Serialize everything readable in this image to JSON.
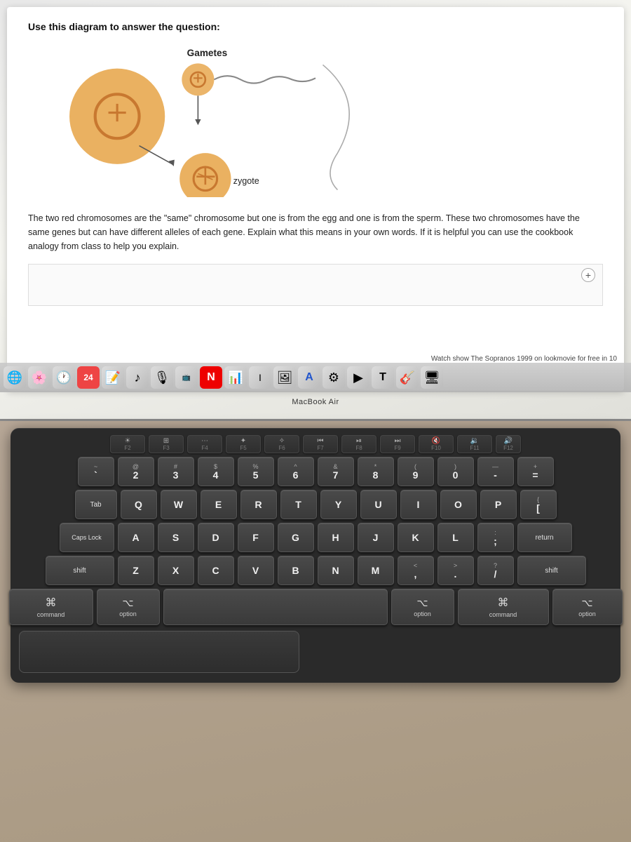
{
  "screen": {
    "question_header": "Use this diagram to answer the question:",
    "gametes_label": "Gametes",
    "zygote_label": "zygote",
    "question_text": "The two red chromosomes are the \"same\" chromosome but one is from the egg and one is from the sperm. These two chromosomes have the same genes but can have different alleles of each gene.  Explain what this means in your own words.  If it is helpful you can use the cookbook analogy from class to help you explain.",
    "notification": "Watch show The Sopranos 1999 on lookmovie for free in 10",
    "macbook_label": "MacBook Air"
  },
  "keyboard": {
    "fn_row": [
      {
        "label": "F2",
        "symbol": "☀"
      },
      {
        "label": "F3",
        "symbol": "⊞"
      },
      {
        "label": "F4",
        "symbol": "⋯"
      },
      {
        "label": "F5",
        "symbol": "⌨"
      },
      {
        "label": "F6",
        "symbol": "⌨"
      },
      {
        "label": "F7",
        "symbol": "⏮"
      },
      {
        "label": "F8",
        "symbol": "⏯"
      },
      {
        "label": "F9",
        "symbol": "⏭"
      },
      {
        "label": "F10",
        "symbol": "🔇"
      },
      {
        "label": "F11",
        "symbol": "🔉"
      }
    ],
    "row1": [
      {
        "top": "@",
        "bottom": "2"
      },
      {
        "top": "#",
        "bottom": "3"
      },
      {
        "top": "$",
        "bottom": "4"
      },
      {
        "top": "%",
        "bottom": "5"
      },
      {
        "top": "^",
        "bottom": "6"
      },
      {
        "top": "&",
        "bottom": "7"
      },
      {
        "top": "*",
        "bottom": "8"
      },
      {
        "top": "(",
        "bottom": "9"
      },
      {
        "top": ")",
        "bottom": "0"
      },
      {
        "top": "—",
        "bottom": "-"
      },
      {
        "top": "+",
        "bottom": "="
      }
    ],
    "row2": [
      "W",
      "E",
      "R",
      "T",
      "Y",
      "U",
      "I",
      "O",
      "P"
    ],
    "row3": [
      "S",
      "D",
      "F",
      "G",
      "H",
      "J",
      "K",
      "L"
    ],
    "row4": [
      "X",
      "C",
      "V",
      "B",
      "N",
      "M"
    ],
    "bottom": {
      "command_label": "command",
      "option_label": "option",
      "cmd_symbol": "⌘"
    }
  }
}
